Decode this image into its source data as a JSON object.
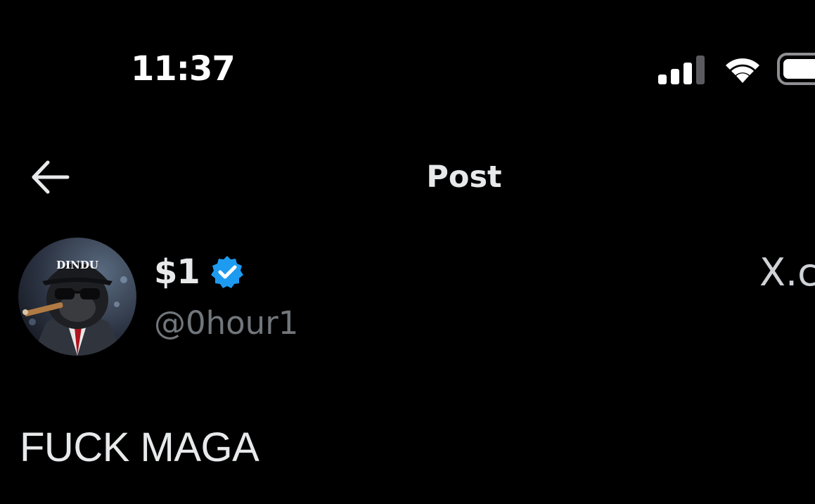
{
  "status_bar": {
    "time": "11:37",
    "signal_icon": "cellular-signal-icon",
    "wifi_icon": "wifi-icon",
    "battery_icon": "battery-icon"
  },
  "nav": {
    "back_icon": "arrow-left-icon",
    "title": "Post"
  },
  "author": {
    "display_name": "$1",
    "verified": true,
    "verified_color": "#1d9bf0",
    "handle": "@0hour1",
    "avatar_cap_text": "DINDU",
    "trailing_text": "X.c"
  },
  "post": {
    "text": "FUCK MAGA"
  },
  "colors": {
    "background": "#000000",
    "primary_text": "#e7e9ea",
    "secondary_text": "#71767b",
    "accent": "#1d9bf0"
  }
}
